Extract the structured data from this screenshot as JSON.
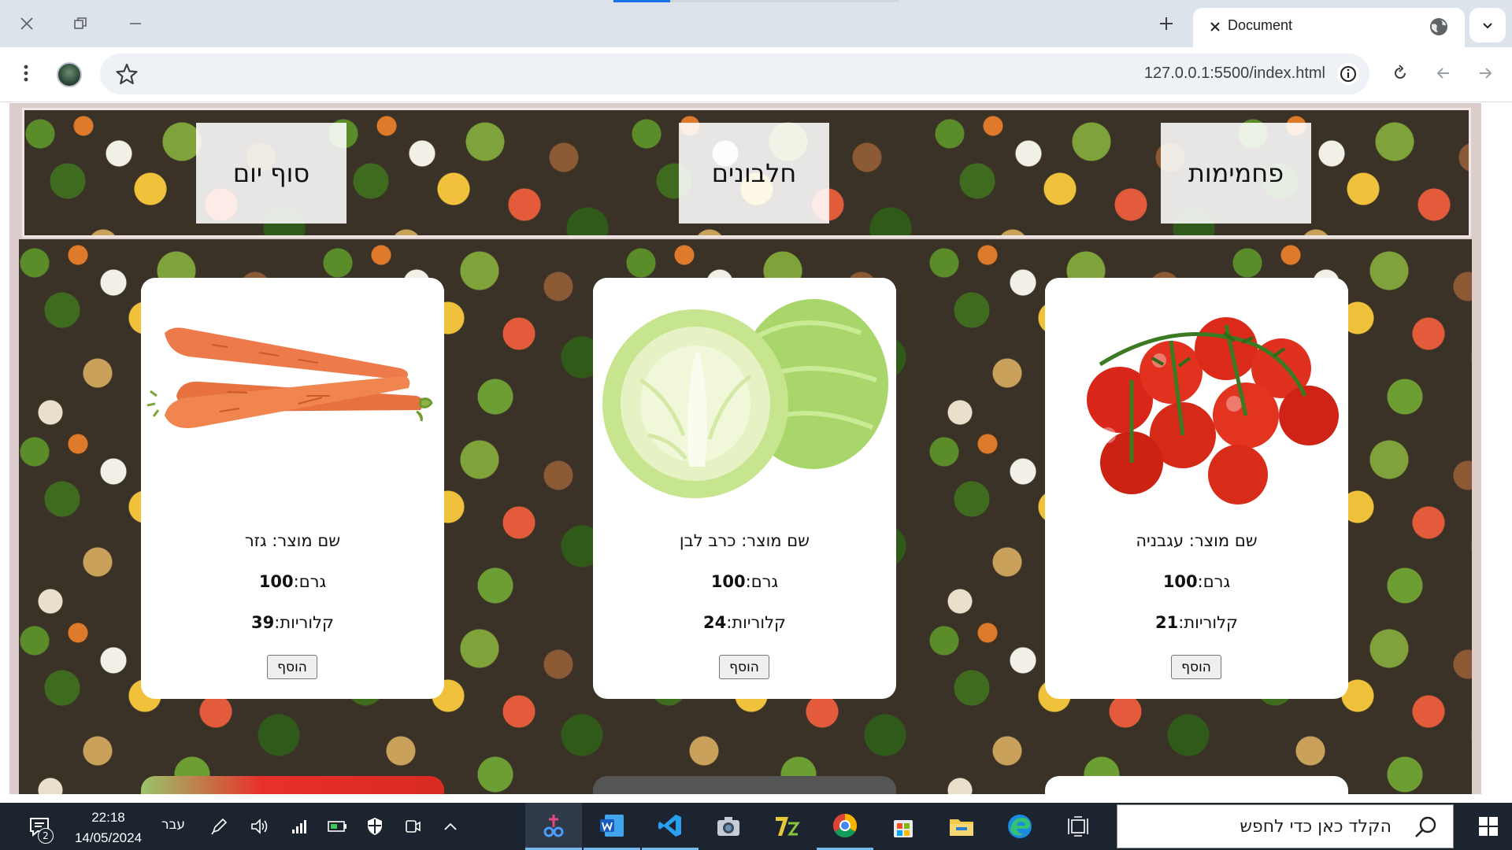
{
  "browser": {
    "tab_title": "Document",
    "url": "127.0.0.1:5500/index.html"
  },
  "nav": {
    "items": [
      "פחמימות",
      "חלבונים",
      "סוף יום"
    ]
  },
  "products": [
    {
      "name_label": "שם מוצר:",
      "name": "עגבניה",
      "grams_label": "גרם:",
      "grams": "100",
      "calories_label": "קלוריות:",
      "calories": "21",
      "add_label": "הוסף",
      "image": "tomato"
    },
    {
      "name_label": "שם מוצר:",
      "name": "כרב לבן",
      "grams_label": "גרם:",
      "grams": "100",
      "calories_label": "קלוריות:",
      "calories": "24",
      "add_label": "הוסף",
      "image": "cabbage"
    },
    {
      "name_label": "שם מוצר:",
      "name": "גזר",
      "grams_label": "גרם:",
      "grams": "100",
      "calories_label": "קלוריות:",
      "calories": "39",
      "add_label": "הוסף",
      "image": "carrot"
    }
  ],
  "taskbar": {
    "search_placeholder": "הקלד כאן כדי לחפש",
    "time": "22:18",
    "date": "14/05/2024",
    "language": "עבר",
    "notifications": "2"
  },
  "colors": {
    "page_background": "#dccccc",
    "taskbar": "#1c2430",
    "accent": "#1a73e8"
  }
}
